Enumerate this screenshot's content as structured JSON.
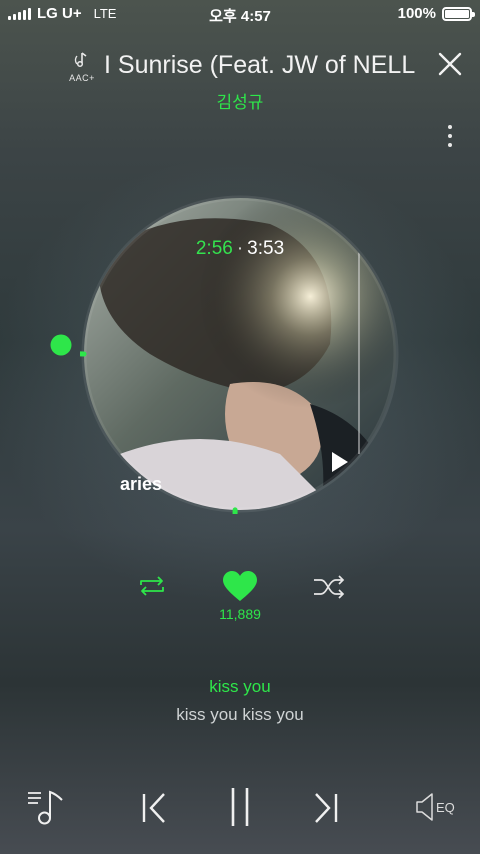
{
  "status_bar": {
    "carrier": "LG U+",
    "network": "LTE",
    "time": "오후 4:57",
    "battery": "100%"
  },
  "header": {
    "quality_badge": "AAC+",
    "song_title": "I Sunrise (Feat. JW of NELL",
    "artist": "김성규"
  },
  "player": {
    "elapsed": "2:56",
    "separator": "·",
    "total": "3:53",
    "progress": 0.755,
    "album_art_text": "aries",
    "likes": "11,889"
  },
  "lyrics": {
    "current": "kiss you",
    "next": "kiss you kiss you"
  },
  "bottom": {
    "eq_label": "EQ"
  },
  "colors": {
    "accent": "#2ee64a",
    "text": "#ffffff"
  },
  "icons": [
    "playlist-icon",
    "previous-icon",
    "pause-icon",
    "next-icon",
    "eq-icon",
    "repeat-icon",
    "heart-icon",
    "shuffle-icon",
    "close-icon",
    "more-icon",
    "aac-icon"
  ]
}
